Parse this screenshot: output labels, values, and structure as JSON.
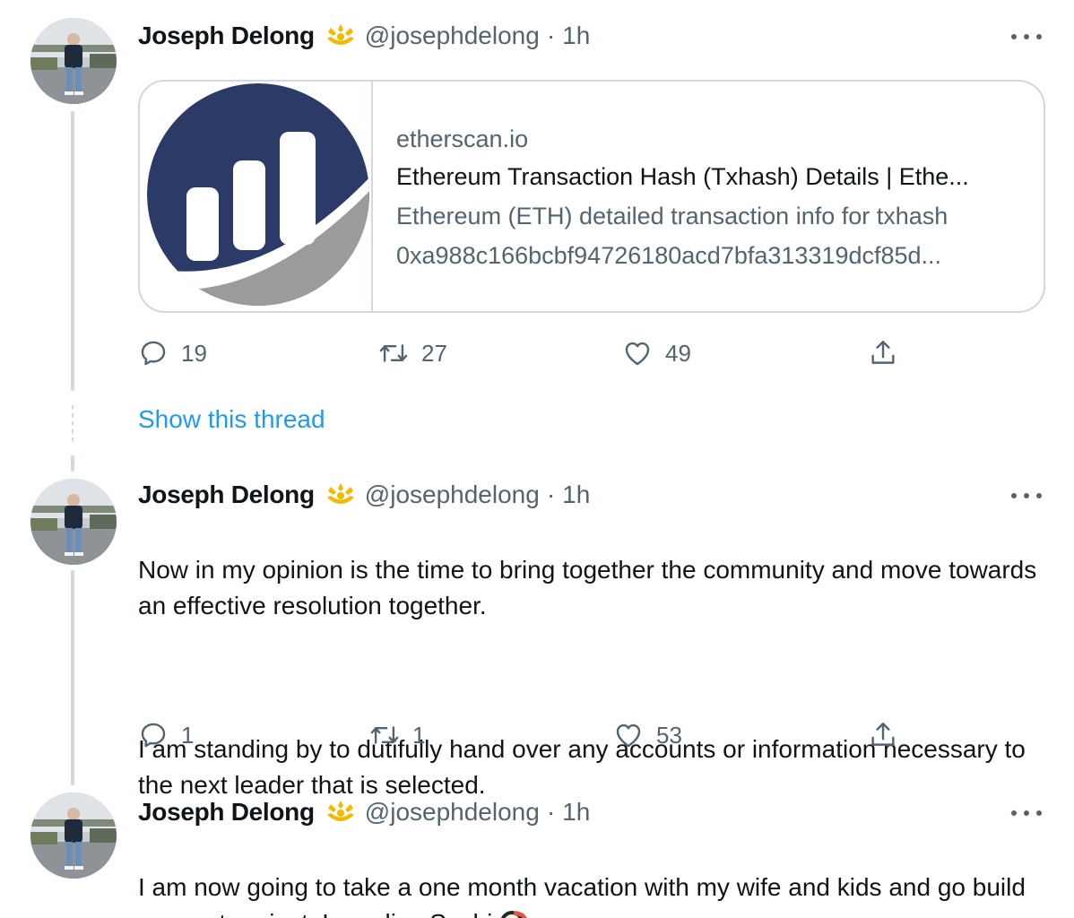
{
  "colors": {
    "text_primary": "#0f1419",
    "text_secondary": "#536471",
    "link": "#1d9bf0",
    "border": "#cfd9de",
    "badge_gold": "#f5b800",
    "etherscan_navy": "#2b3a67"
  },
  "tweets": [
    {
      "author": {
        "name": "Joseph Delong",
        "handle": "@josephdelong",
        "badge_icon": "sushi-affiliate-badge-icon"
      },
      "separator": "·",
      "time": "1h",
      "card": {
        "domain": "etherscan.io",
        "title": "Ethereum Transaction Hash (Txhash) Details | Ethe...",
        "description_line1": "Ethereum (ETH) detailed transaction info for txhash",
        "description_line2": "0xa988c166bcbf94726180acd7bfa313319dcf85d...",
        "image_icon": "etherscan-logo-icon"
      },
      "actions": {
        "replies": "19",
        "retweets": "27",
        "likes": "49"
      },
      "show_thread": "Show this thread"
    },
    {
      "author": {
        "name": "Joseph Delong",
        "handle": "@josephdelong",
        "badge_icon": "sushi-affiliate-badge-icon"
      },
      "separator": "·",
      "time": "1h",
      "text_p1": "Now in my opinion is the time to bring together the community and move towards an effective resolution together.",
      "text_p2": "I am standing by to dutifully hand over any accounts or information necessary to the next leader that is selected.",
      "actions": {
        "replies": "1",
        "retweets": "1",
        "likes": "53"
      }
    },
    {
      "author": {
        "name": "Joseph Delong",
        "handle": "@josephdelong",
        "badge_icon": "sushi-affiliate-badge-icon"
      },
      "separator": "·",
      "time": "1h",
      "text": "I am now going to take a one month vacation with my wife and kids and go build my next project. Long live Sushi",
      "emoji_icon": "sushi-emoji-icon"
    }
  ],
  "icons": {
    "reply": "reply-icon",
    "retweet": "retweet-icon",
    "like": "heart-icon",
    "share": "share-icon",
    "more": "more-icon"
  }
}
